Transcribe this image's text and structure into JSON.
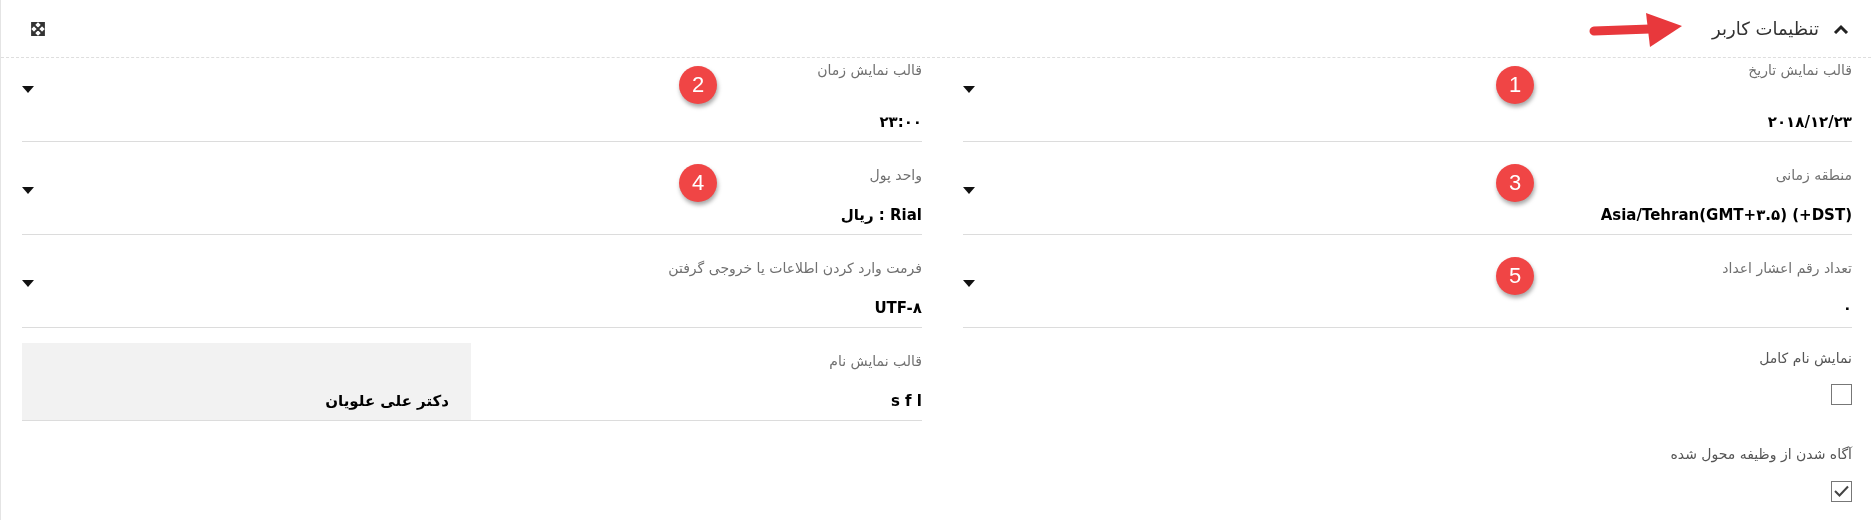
{
  "panel": {
    "title": "تنظیمات کاربر",
    "expanded": true
  },
  "fields_right": [
    {
      "kind": "select",
      "label": "قالب نمایش تاریخ",
      "value": "۲۰۱۸/۱۲/۲۳",
      "badge": "1"
    },
    {
      "kind": "select",
      "label": "منطقه زمانی",
      "value": "Asia/Tehran(GMT+۳.۵) (+DST)",
      "badge": "3"
    },
    {
      "kind": "select",
      "label": "تعداد رقم اعشار اعداد",
      "value": "۰",
      "badge": "5"
    }
  ],
  "checkboxes": [
    {
      "label": "نمایش نام کامل",
      "checked": false
    },
    {
      "label": "آگاه شدن از وظیفه محول شده",
      "checked": true
    }
  ],
  "fields_left": [
    {
      "kind": "select",
      "label": "قالب نمایش زمان",
      "value": "۲۳:۰۰",
      "badge": "2"
    },
    {
      "kind": "select",
      "label": "واحد پول",
      "value": "Rial : ریال",
      "badge": "4"
    },
    {
      "kind": "select",
      "label": "فرمت وارد کردن اطلاعات یا خروجی گرفتن",
      "value": "UTF-۸"
    },
    {
      "kind": "preview",
      "label": "قالب نمایش نام",
      "value": "s f l",
      "preview": "دکتر علی علویان"
    }
  ]
}
